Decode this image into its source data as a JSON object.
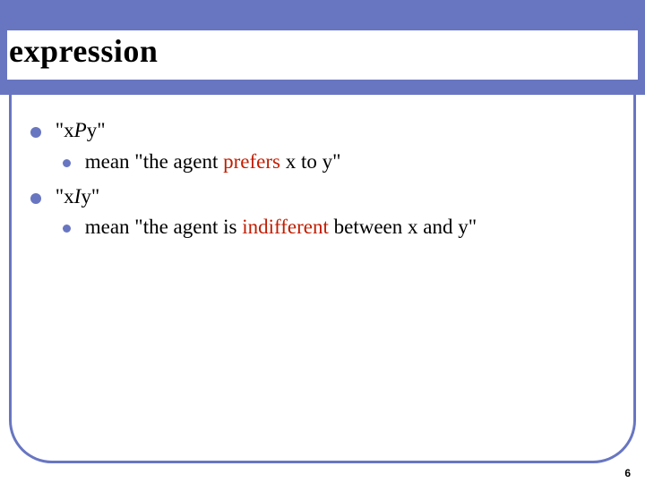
{
  "title": "expression",
  "items": [
    {
      "head_prefix": "\"x",
      "operator": "P",
      "head_suffix": "y\"",
      "subs": [
        {
          "pre": "mean \"the agent ",
          "hl": "prefers",
          "post": " x to y\""
        }
      ]
    },
    {
      "head_prefix": "\"x",
      "operator": "I",
      "head_suffix": "y\"",
      "subs": [
        {
          "pre": "mean \"the agent is ",
          "hl": "indifferent",
          "post": " between x and y\""
        }
      ]
    }
  ],
  "page_number": "6"
}
